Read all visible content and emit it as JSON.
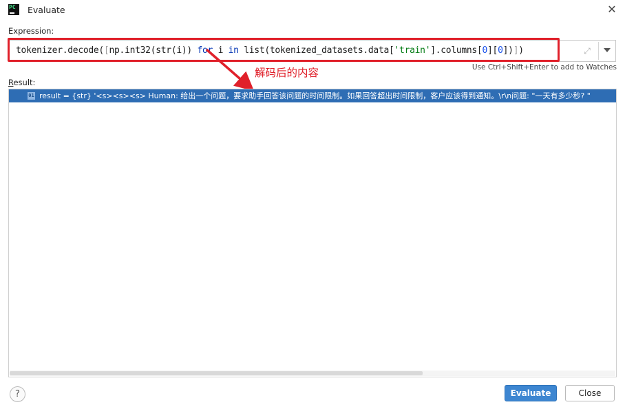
{
  "window": {
    "title": "Evaluate",
    "app_icon_text": "PC"
  },
  "expression": {
    "label": "Expression:",
    "parts": [
      {
        "t": "tokenizer.decode(",
        "c": ""
      },
      {
        "t": "[",
        "c": "sq"
      },
      {
        "t": "np.int32(str(i)) ",
        "c": ""
      },
      {
        "t": "for",
        "c": "kw"
      },
      {
        "t": " i ",
        "c": ""
      },
      {
        "t": "in",
        "c": "kw"
      },
      {
        "t": " list(tokenized_datasets.data[",
        "c": ""
      },
      {
        "t": "'train'",
        "c": "str"
      },
      {
        "t": "].columns[",
        "c": ""
      },
      {
        "t": "0",
        "c": "num"
      },
      {
        "t": "][",
        "c": ""
      },
      {
        "t": "0",
        "c": "num"
      },
      {
        "t": "])",
        "c": ""
      },
      {
        "t": "]",
        "c": "sq"
      },
      {
        "t": ")",
        "c": ""
      }
    ],
    "hint": "Use Ctrl+Shift+Enter to add to Watches"
  },
  "annotation": {
    "text": "解码后的内容",
    "color": "#e0202a"
  },
  "result": {
    "label_underlined": "R",
    "label_rest": "esult:",
    "row_icon": "01",
    "row_text": "result = {str} '<s><s><s> Human: 给出一个问题，要求助手回答该问题的时间限制。如果回答超出时间限制，客户应该得到通知。\\r\\n问题: \"一天有多少秒? \""
  },
  "buttons": {
    "help": "?",
    "evaluate": "Evaluate",
    "close": "Close"
  },
  "colors": {
    "accent": "#3d86d1",
    "selection": "#2e6db4",
    "annotation_red": "#e0202a"
  }
}
